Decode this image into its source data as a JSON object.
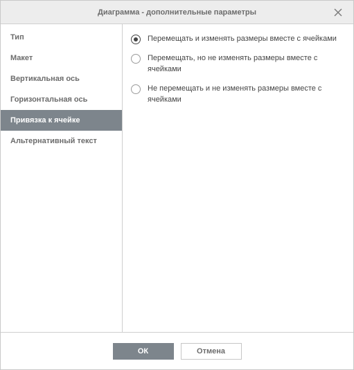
{
  "dialog": {
    "title": "Диаграмма - дополнительные параметры"
  },
  "sidebar": {
    "items": [
      {
        "label": "Тип",
        "selected": false
      },
      {
        "label": "Макет",
        "selected": false
      },
      {
        "label": "Вертикальная ось",
        "selected": false
      },
      {
        "label": "Горизонтальная ось",
        "selected": false
      },
      {
        "label": "Привязка к ячейке",
        "selected": true
      },
      {
        "label": "Альтернативный текст",
        "selected": false
      }
    ]
  },
  "content": {
    "radios": [
      {
        "label": "Перемещать и изменять размеры вместе с ячейками",
        "checked": true
      },
      {
        "label": "Перемещать, но не изменять размеры вместе с ячейками",
        "checked": false
      },
      {
        "label": "Не перемещать и не изменять размеры вместе с ячейками",
        "checked": false
      }
    ]
  },
  "footer": {
    "ok_label": "ОК",
    "cancel_label": "Отмена"
  }
}
